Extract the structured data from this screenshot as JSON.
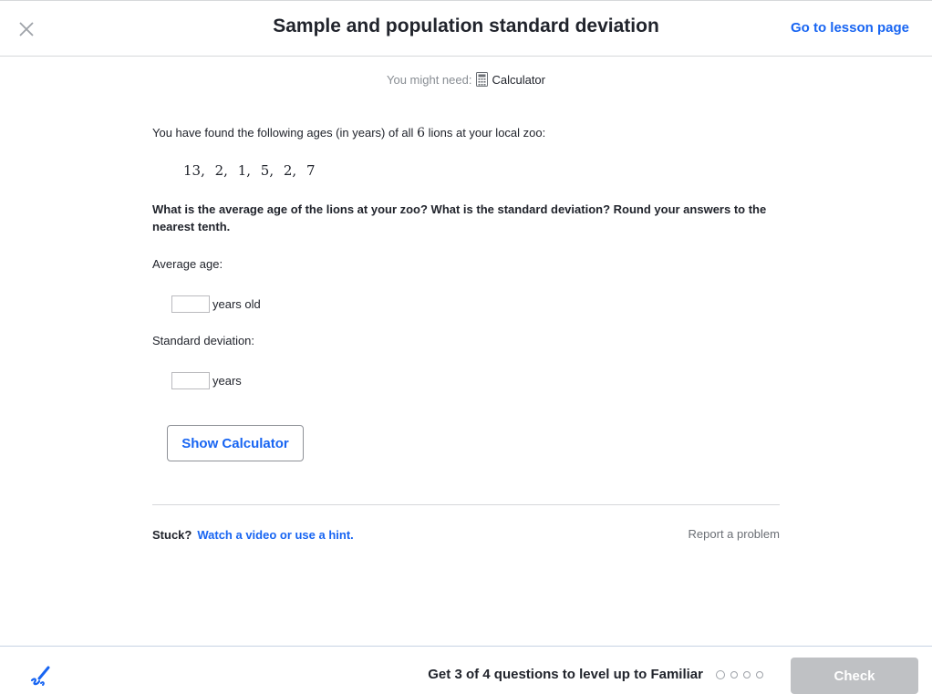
{
  "header": {
    "title": "Sample and population standard deviation",
    "lesson_link": "Go to lesson page"
  },
  "might_need": {
    "prefix": "You might need:",
    "tool": "Calculator"
  },
  "problem": {
    "intro_before": "You have found the following ages (in years) of all",
    "intro_count": "6",
    "intro_after": "lions at your local zoo:",
    "ages_text": "13,  2,  1,  5,  2,  7",
    "question": "What is the average age of the lions at your zoo? What is the standard deviation? Round your answers to the nearest tenth.",
    "average_label": "Average age:",
    "average_unit": "years old",
    "average_value": "",
    "sd_label": "Standard deviation:",
    "sd_unit": "years",
    "sd_value": "",
    "show_calculator": "Show Calculator"
  },
  "help": {
    "stuck": "Stuck?",
    "hint_link": "Watch a video or use a hint.",
    "report": "Report a problem"
  },
  "footer": {
    "levelup_text": "Get 3 of 4 questions to level up to Familiar",
    "check": "Check",
    "progress_total": 4,
    "progress_done": 0
  },
  "colors": {
    "accent": "#1865f2",
    "text": "#21242c",
    "muted": "#888d93",
    "check_disabled": "#bfc1c4"
  }
}
